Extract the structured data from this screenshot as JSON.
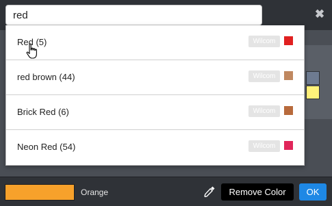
{
  "search": {
    "value": "red"
  },
  "close_glyph": "✖",
  "results": [
    {
      "label": "Red (5)",
      "brand": "Wilcom",
      "color": "#e02020"
    },
    {
      "label": "red brown (44)",
      "brand": "Wilcom",
      "color": "#c08860"
    },
    {
      "label": "Brick Red (6)",
      "brand": "Wilcom",
      "color": "#b86a3c"
    },
    {
      "label": "Neon Red (54)",
      "brand": "Wilcom",
      "color": "#e0265a"
    }
  ],
  "background_swatches": [
    "#6e7b91",
    "#fff27a"
  ],
  "current_color": {
    "name": "Orange",
    "color": "#f7a12b"
  },
  "buttons": {
    "remove": "Remove Color",
    "ok": "OK"
  },
  "icons": {
    "eyedropper": "eyedropper-icon",
    "close": "close-icon",
    "cursor": "hand-pointer-cursor"
  }
}
